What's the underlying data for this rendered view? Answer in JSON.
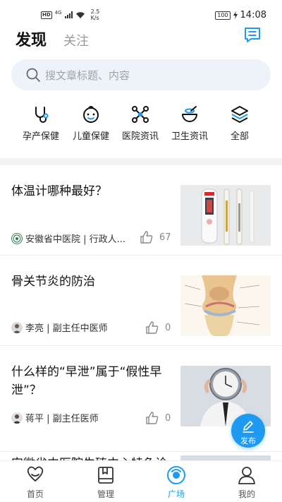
{
  "status_bar": {
    "hd": "HD",
    "network": "4G",
    "speed_value": "2.5",
    "speed_unit": "K/s",
    "battery": "100",
    "time": "14:08"
  },
  "header": {
    "tab_discover": "发现",
    "tab_follow": "关注"
  },
  "search": {
    "placeholder": "搜文章标题、内容"
  },
  "categories": [
    {
      "label": "孕产保健",
      "icon": "stethoscope-icon"
    },
    {
      "label": "儿童保健",
      "icon": "baby-face-icon"
    },
    {
      "label": "医院资讯",
      "icon": "network-icon"
    },
    {
      "label": "卫生资讯",
      "icon": "medicine-bowl-icon"
    },
    {
      "label": "全部",
      "icon": "layers-icon"
    }
  ],
  "articles": [
    {
      "title": "体温计哪种最好？",
      "author": "安徽省中医院 | 行政人...",
      "likes": "67",
      "thumb": "thermometer-image"
    },
    {
      "title": "骨关节炎的防治",
      "author": "李亮 | 副主任中医师",
      "likes": "0",
      "thumb": "knee-joint-image"
    },
    {
      "title": "什么样的“早泄”属于“假性早泄”？",
      "author": "蒋平 | 副主任医师",
      "likes": "0",
      "thumb": "man-with-clock-image"
    },
    {
      "title": "安徽省中医院生殖中心特色诊"
    }
  ],
  "fab": {
    "label": "发布"
  },
  "bottom_nav": [
    {
      "label": "首页",
      "icon": "home-icon"
    },
    {
      "label": "管理",
      "icon": "book-icon"
    },
    {
      "label": "广场",
      "icon": "square-icon"
    },
    {
      "label": "我的",
      "icon": "profile-icon"
    }
  ],
  "colors": {
    "accent": "#1e9af0",
    "search_bg": "#eef3f9"
  }
}
